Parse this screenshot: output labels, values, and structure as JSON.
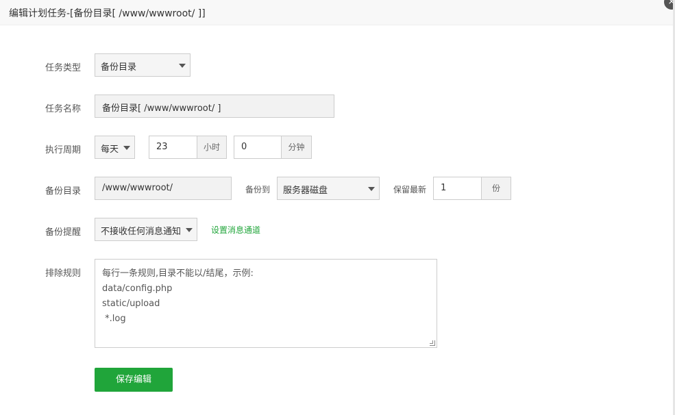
{
  "dialog": {
    "title": "编辑计划任务-[备份目录[ /www/wwwroot/ ]]",
    "close_icon": "×"
  },
  "form": {
    "task_type": {
      "label": "任务类型",
      "value": "备份目录"
    },
    "task_name": {
      "label": "任务名称",
      "value": "备份目录[ /www/wwwroot/ ]"
    },
    "cycle": {
      "label": "执行周期",
      "period": "每天",
      "hour": "23",
      "hour_unit": "小时",
      "minute": "0",
      "minute_unit": "分钟"
    },
    "backup_dir": {
      "label": "备份目录",
      "value": "/www/wwwroot/",
      "backup_to_label": "备份到",
      "backup_to_value": "服务器磁盘",
      "keep_label": "保留最新",
      "keep_value": "1",
      "keep_unit": "份"
    },
    "notify": {
      "label": "备份提醒",
      "value": "不接收任何消息通知",
      "link": "设置消息通道"
    },
    "exclude": {
      "label": "排除规则",
      "placeholder_lines": [
        "每行一条规则,目录不能以/结尾，示例:",
        "data/config.php",
        "static/upload",
        " *.log"
      ]
    },
    "save_label": "保存编辑"
  },
  "colors": {
    "accent": "#20a53a",
    "header_bg": "#f8f8f8",
    "border": "#cccccc"
  }
}
